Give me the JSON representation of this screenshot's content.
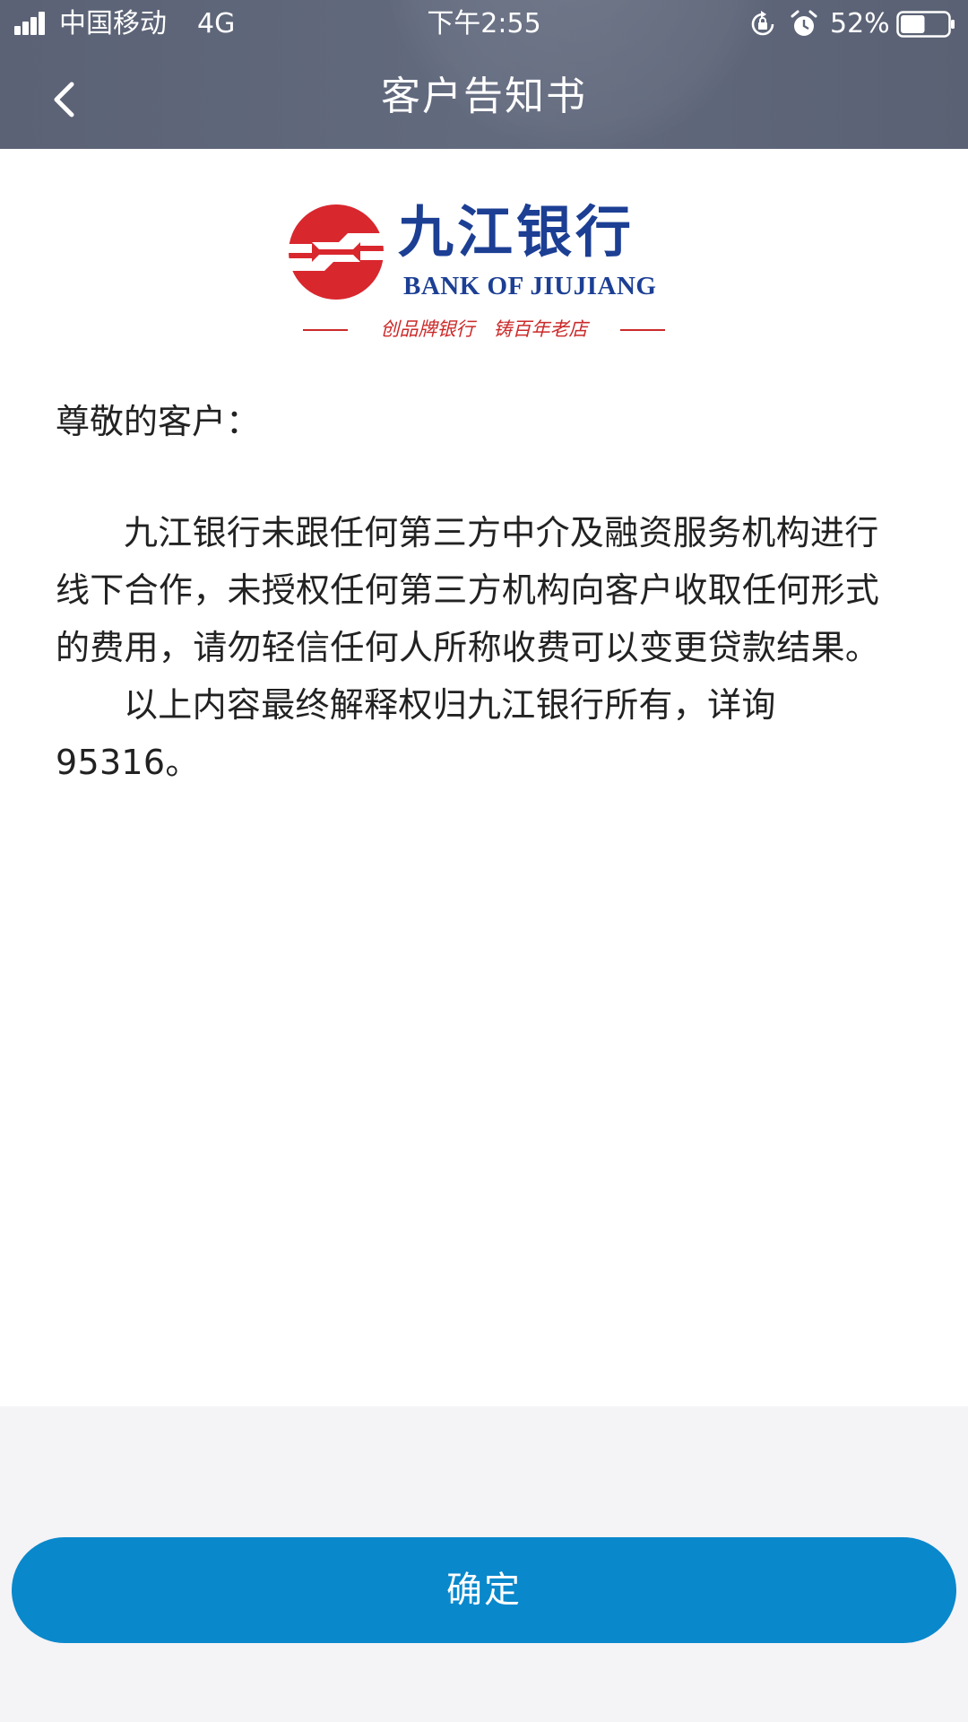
{
  "status_bar": {
    "carrier": "中国移动",
    "network": "4G",
    "time": "下午2:55",
    "battery_percent": "52%",
    "battery_level": 0.52,
    "icons": [
      "signal-icon",
      "rotation-lock-icon",
      "alarm-clock-icon",
      "battery-icon"
    ]
  },
  "nav": {
    "back_icon": "chevron-left-icon",
    "title": "客户告知书"
  },
  "logo": {
    "name_cn": "九江银行",
    "name_en": "BANK OF JIUJIANG",
    "slogan": "创品牌银行　铸百年老店",
    "colors": {
      "red": "#d9272e",
      "blue": "#1c3f94"
    }
  },
  "notice": {
    "greeting": "尊敬的客户：",
    "paragraphs": [
      "九江银行未跟任何第三方中介及融资服务机构进行线下合作，未授权任何第三方机构向客户收取任何形式的费用，请勿轻信任何人所称收费可以变更贷款结果。",
      "以上内容最终解释权归九江银行所有，详询95316。"
    ]
  },
  "footer": {
    "confirm_label": "确定",
    "button_color": "#0a88cc"
  }
}
